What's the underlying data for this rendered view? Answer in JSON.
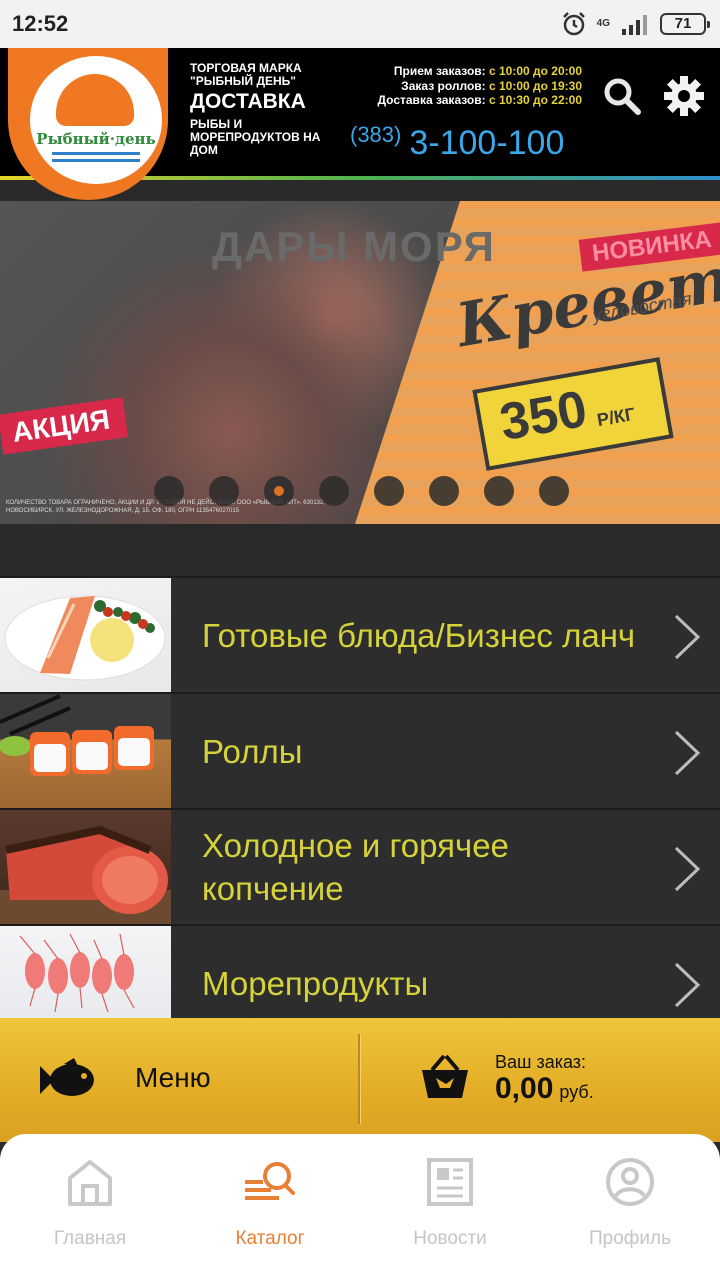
{
  "status_bar": {
    "time": "12:52",
    "network": "4G",
    "battery": "71",
    "icons": [
      "alarm-icon",
      "signal-icon",
      "battery-icon"
    ]
  },
  "header": {
    "logo_text": "Рыбный·день",
    "brand_small": "ТОРГОВАЯ МАРКА \"РЫБНЫЙ ДЕНЬ\"",
    "brand_big": "ДОСТАВКА",
    "brand_desc": "РЫБЫ И МОРЕПРОДУКТОВ НА ДОМ",
    "hours": [
      {
        "label": "Прием заказов:",
        "value": "с 10:00 до 20:00"
      },
      {
        "label": "Заказ роллов:",
        "value": "с 10:00 до 19:30"
      },
      {
        "label": "Доставка заказов:",
        "value": "с 10:30 до 22:00"
      }
    ],
    "phone_code": "(383)",
    "phone_number": "3-100-100",
    "accent_color": "#f07823",
    "phone_color": "#39a7e8",
    "highlight_color": "#e6d23a"
  },
  "banner": {
    "title": "ДАРЫ МОРЯ",
    "badge_new": "НОВИНКА",
    "product": "Креветка",
    "product_sub": "угловостая",
    "price_value": "350",
    "price_unit": "Р/КГ",
    "promo": "АКЦИЯ",
    "fine_print": "КОЛИЧЕСТВО ТОВАРА ОГРАНИЧЕНО, АКЦИИ И ДР. УСЛОВИЯ НЕ ДЕЙСТВУЮТ. ООО «РЫБНЫЙ ХИТ», 630132, НОВОСИБИРСК, УЛ. ЖЕЛЕЗНОДОРОЖНАЯ, Д. 15, ОФ. 180, ОГРН 1135476027015",
    "slides_count": 8,
    "active_slide": 3
  },
  "catalog": {
    "items": [
      {
        "label": "Готовые блюда/Бизнес ланч"
      },
      {
        "label": "Роллы"
      },
      {
        "label": "Холодное и горячее копчение"
      },
      {
        "label": "Морепродукты"
      }
    ],
    "label_color": "#d6d23a"
  },
  "action_bar": {
    "menu_label": "Меню",
    "order_title": "Ваш заказ:",
    "order_total": "0,00",
    "order_currency": "руб."
  },
  "bottom_nav": {
    "items": [
      {
        "label": "Главная",
        "icon": "home-icon"
      },
      {
        "label": "Каталог",
        "icon": "catalog-search-icon",
        "active": true
      },
      {
        "label": "Новости",
        "icon": "news-icon"
      },
      {
        "label": "Профиль",
        "icon": "profile-icon"
      }
    ],
    "active_color": "#e97f33"
  }
}
